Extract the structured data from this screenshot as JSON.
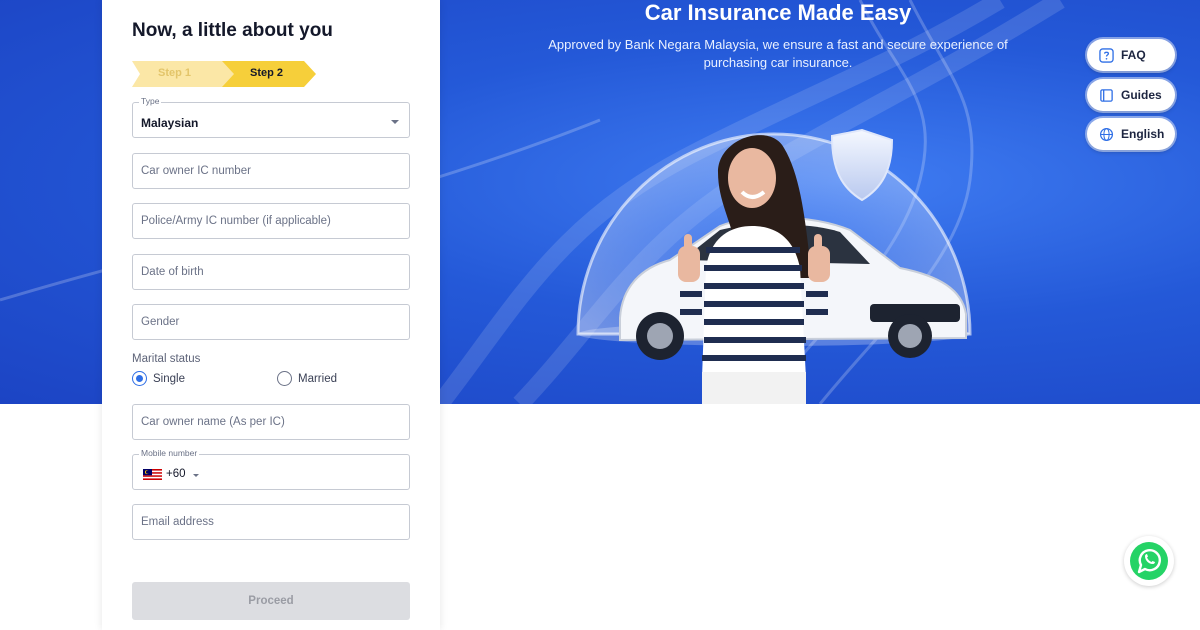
{
  "hero": {
    "title": "Car Insurance Made Easy",
    "subtitle": "Approved by Bank Negara Malaysia, we ensure a fast and secure experience of purchasing car insurance."
  },
  "side_buttons": [
    {
      "label": "FAQ",
      "icon": "help-circle-icon"
    },
    {
      "label": "Guides",
      "icon": "book-icon"
    },
    {
      "label": "English",
      "icon": "globe-icon"
    }
  ],
  "form": {
    "heading": "Now, a little about you",
    "steps": [
      {
        "label": "Step 1",
        "state": "done"
      },
      {
        "label": "Step 2",
        "state": "active"
      }
    ],
    "type": {
      "legend": "Type",
      "value": "Malaysian"
    },
    "ic_placeholder": "Car owner IC number",
    "police_placeholder": "Police/Army IC number (if applicable)",
    "dob_placeholder": "Date of birth",
    "gender_placeholder": "Gender",
    "marital": {
      "label": "Marital status",
      "options": [
        "Single",
        "Married"
      ],
      "selected": "Single"
    },
    "name_placeholder": "Car owner name (As per IC)",
    "mobile": {
      "legend": "Mobile number",
      "dial_code": "+60",
      "flag_icon": "malaysia-flag-icon"
    },
    "email_placeholder": "Email address",
    "proceed_label": "Proceed"
  },
  "colors": {
    "hero_blue": "#2459d8",
    "step_active": "#f6cf3a",
    "step_done": "#fbe7a6",
    "radio_accent": "#2f6fe6",
    "whatsapp_green": "#25d366"
  }
}
